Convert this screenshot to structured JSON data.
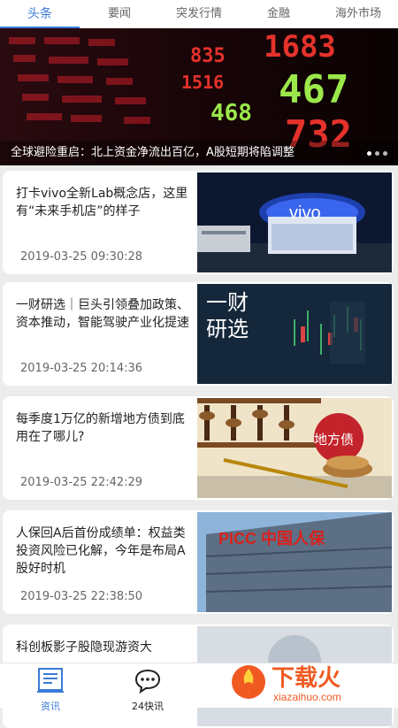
{
  "tabs": [
    "头条",
    "要闻",
    "突发行情",
    "金融",
    "海外市场"
  ],
  "banner": {
    "caption": "全球避险重启：北上资金净流出百亿，A股短期将陷调整",
    "board_numbers": [
      "1683",
      "467",
      "468",
      "732",
      "835",
      "1516"
    ]
  },
  "articles": [
    {
      "title": "打卡vivo全新Lab概念店，这里有“未来手机店”的样子",
      "date": "2019-03-25 09:30:28",
      "thumb_text": "vivo"
    },
    {
      "title": "一财研选｜巨头引领叠加政策、资本推动，智能驾驶产业化提速",
      "date": "2019-03-25 20:14:36",
      "thumb_text": "一财\n研选"
    },
    {
      "title": "每季度1万亿的新增地方债到底用在了哪儿?",
      "date": "2019-03-25 22:42:29",
      "thumb_text": "地方债"
    },
    {
      "title": "人保回A后首份成绩单：权益类投资风险已化解，今年是布局A股好时机",
      "date": "2019-03-25 22:38:50",
      "thumb_text": "PICC 中国人保"
    },
    {
      "title": "科创板影子股隐现游资大",
      "date": "",
      "thumb_text": ""
    }
  ],
  "bottom_nav": [
    {
      "label": "资讯",
      "icon": "newspaper-icon",
      "active": true
    },
    {
      "label": "24快讯",
      "icon": "chat-bubble-icon",
      "active": false
    }
  ],
  "watermark": {
    "brand": "下载火",
    "url": "xiazaihuo.com"
  },
  "colors": {
    "accent": "#3a7bd5",
    "board_red": "#e4322b",
    "board_green": "#9be84a",
    "watermark_orange": "#f05a22"
  }
}
